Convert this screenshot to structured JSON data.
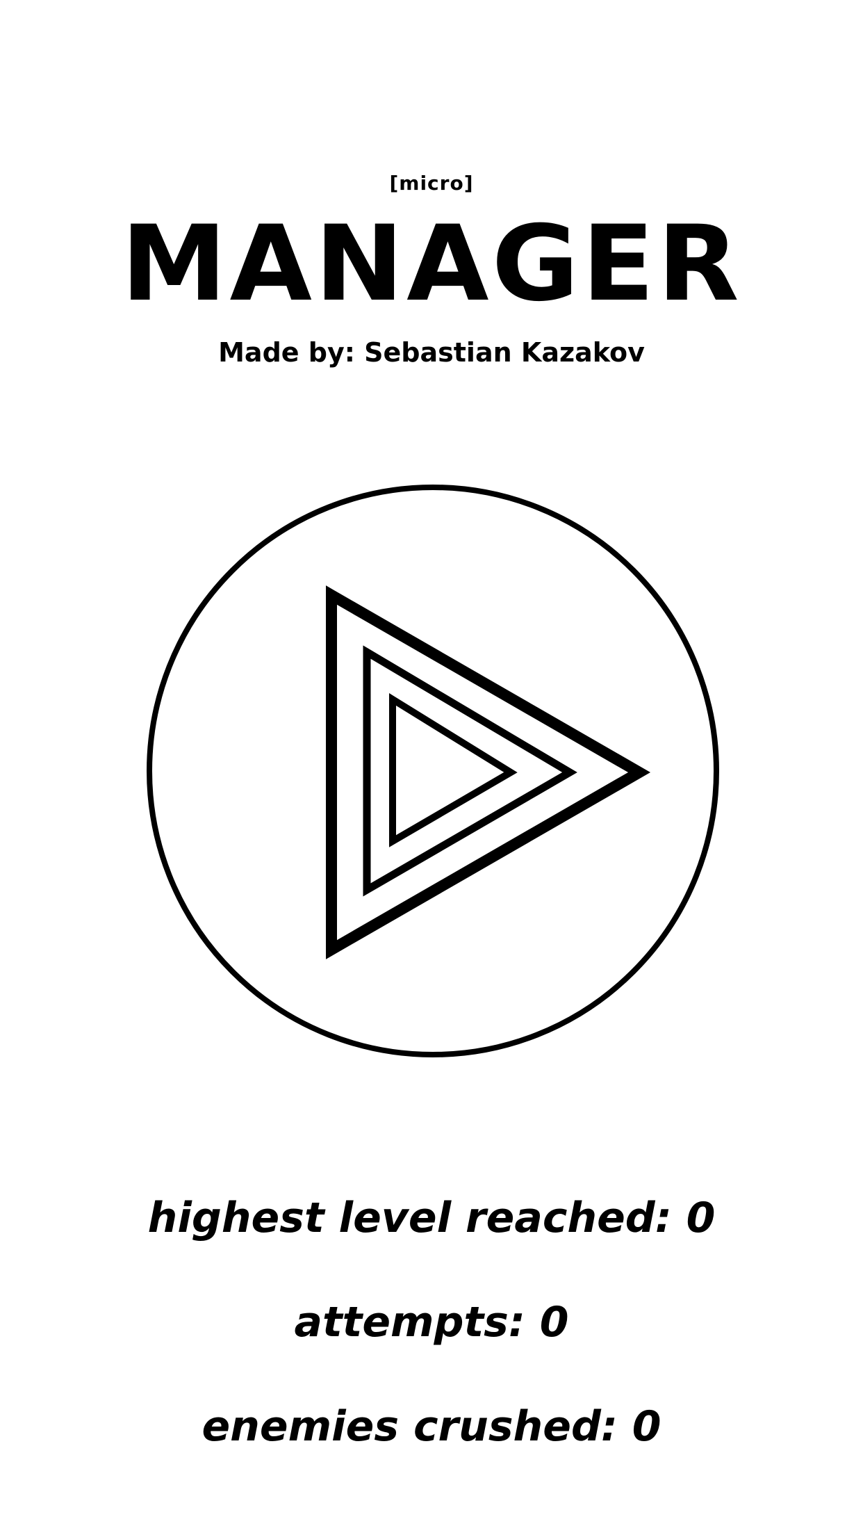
{
  "header": {
    "subtitle": "[micro]",
    "title": "MANAGER",
    "credit": "Made by: Sebastian Kazakov"
  },
  "play": {
    "icon": "play-icon"
  },
  "stats": {
    "highest_level": "highest level reached: 0",
    "attempts": "attempts: 0",
    "enemies_crushed": "enemies crushed: 0"
  }
}
